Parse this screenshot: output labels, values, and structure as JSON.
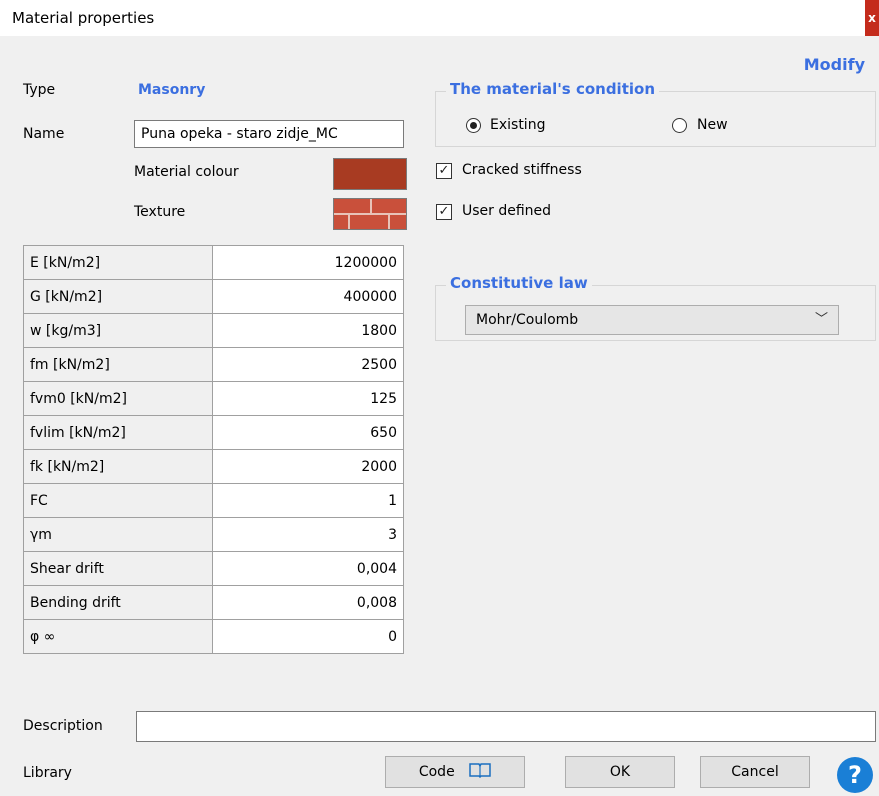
{
  "window": {
    "title": "Material properties",
    "close_label": "x"
  },
  "header": {
    "modify_label": "Modify"
  },
  "type": {
    "label": "Type",
    "value": "Masonry"
  },
  "name": {
    "label": "Name",
    "value": "Puna opeka - staro zidje_MC"
  },
  "material_colour": {
    "label": "Material colour",
    "color": "#a83b22"
  },
  "texture": {
    "label": "Texture",
    "icon": "brick-texture"
  },
  "properties": [
    {
      "name": "E [kN/m2]",
      "value": "1200000"
    },
    {
      "name": "G [kN/m2]",
      "value": "400000"
    },
    {
      "name": "w [kg/m3]",
      "value": "1800"
    },
    {
      "name": "fm [kN/m2]",
      "value": "2500"
    },
    {
      "name": "fvm0 [kN/m2]",
      "value": "125"
    },
    {
      "name": "fvlim [kN/m2]",
      "value": "650"
    },
    {
      "name": "fk [kN/m2]",
      "value": "2000"
    },
    {
      "name": "FC",
      "value": "1"
    },
    {
      "name": "γm",
      "value": "3"
    },
    {
      "name": "Shear drift",
      "value": "0,004"
    },
    {
      "name": "Bending drift",
      "value": "0,008"
    },
    {
      "name": "φ ∞",
      "value": "0"
    }
  ],
  "condition": {
    "title": "The material's condition",
    "options": [
      {
        "label": "Existing",
        "selected": true
      },
      {
        "label": "New",
        "selected": false
      }
    ]
  },
  "checks": {
    "cracked_stiffness": {
      "label": "Cracked stiffness",
      "checked": true
    },
    "user_defined": {
      "label": "User defined",
      "checked": true
    }
  },
  "constitutive_law": {
    "title": "Constitutive law",
    "selected": "Mohr/Coulomb"
  },
  "description": {
    "label": "Description",
    "value": ""
  },
  "library": {
    "label": "Library"
  },
  "buttons": {
    "code": "Code",
    "ok": "OK",
    "cancel": "Cancel",
    "help": "?"
  },
  "colors": {
    "accent": "#3b6fe0",
    "help": "#1a7fd6",
    "close": "#c42b1c"
  }
}
